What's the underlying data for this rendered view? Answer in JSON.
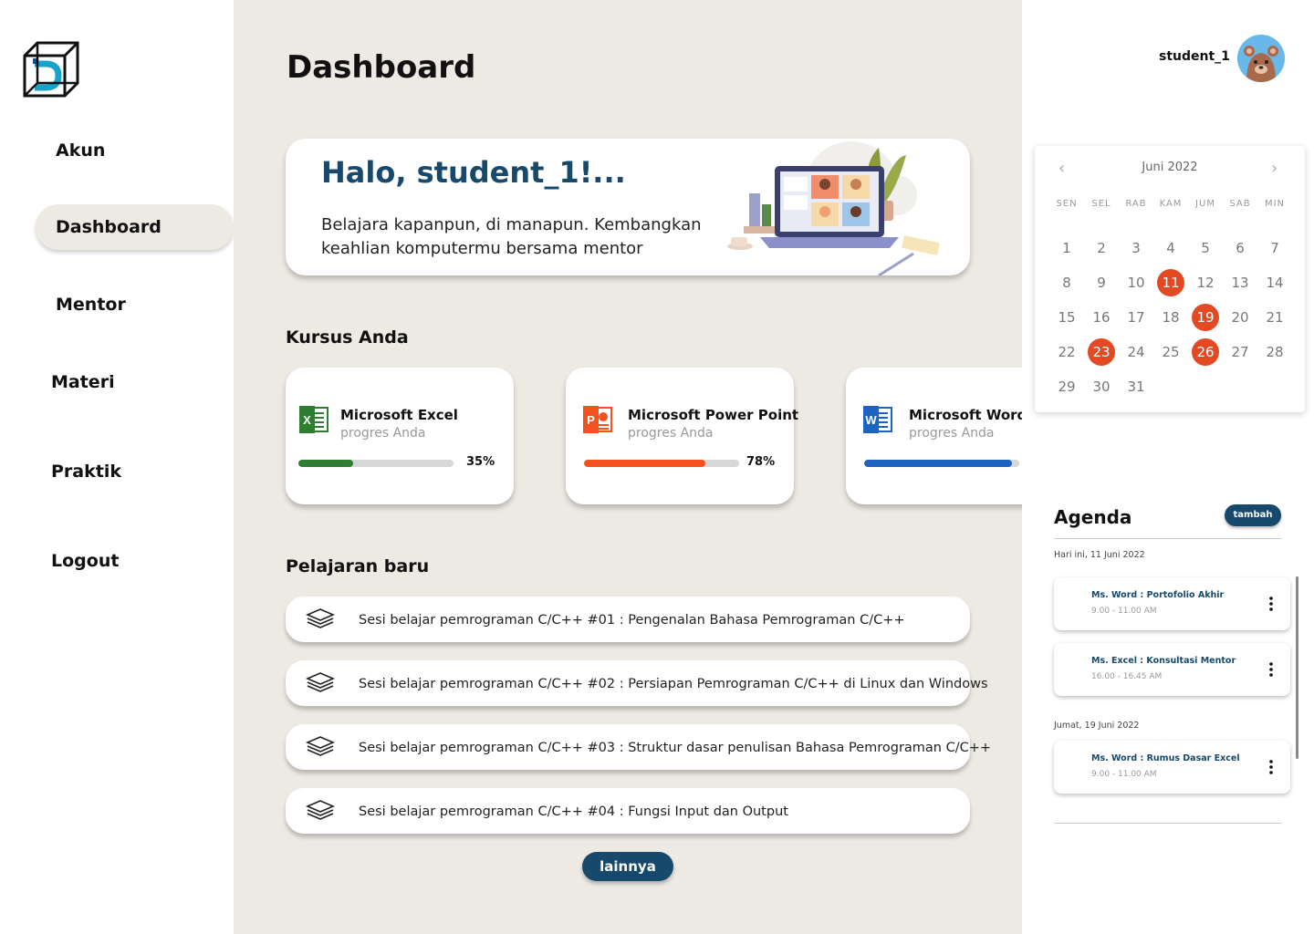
{
  "sidebar": {
    "items": [
      {
        "label": "Akun"
      },
      {
        "label": "Dashboard"
      },
      {
        "label": "Mentor"
      },
      {
        "label": "Materi"
      },
      {
        "label": "Praktik"
      },
      {
        "label": "Logout"
      }
    ],
    "active": "Dashboard"
  },
  "main": {
    "title": "Dashboard",
    "hero": {
      "greeting": "Halo, student_1!...",
      "text": "Belajara kapanpun, di manapun. Kembangkan keahlian komputermu bersama mentor"
    },
    "courses_title": "Kursus Anda",
    "courses": [
      {
        "name": "Microsoft Excel",
        "sub": "progres Anda",
        "progress": 35,
        "progress_label": "35%",
        "color": "#2e7d32",
        "icon": "excel-icon"
      },
      {
        "name": "Microsoft Power Point",
        "sub": "progres Anda",
        "progress": 78,
        "progress_label": "78%",
        "color": "#f4511e",
        "icon": "powerpoint-icon"
      },
      {
        "name": "Microsoft Word",
        "sub": "progres Anda",
        "progress": 95,
        "progress_label": "",
        "color": "#1e63c0",
        "icon": "word-icon"
      }
    ],
    "lessons_title": "Pelajaran baru",
    "lessons": [
      {
        "text": "Sesi belajar pemrograman C/C++ #01 : Pengenalan Bahasa Pemrograman C/C++"
      },
      {
        "text": "Sesi belajar pemrograman C/C++ #02 : Persiapan Pemrograman C/C++ di Linux dan Windows"
      },
      {
        "text": "Sesi belajar pemrograman C/C++ #03 : Struktur dasar penulisan Bahasa Pemrograman C/C++"
      },
      {
        "text": "Sesi belajar pemrograman C/C++ #04 : Fungsi Input dan Output"
      }
    ],
    "more_label": "lainnya"
  },
  "right": {
    "username": "student_1",
    "calendar": {
      "month": "Juni 2022",
      "prev": "‹",
      "next": "›",
      "weekdays": [
        "SEN",
        "SEL",
        "RAB",
        "KAM",
        "JUM",
        "SAB",
        "MIN"
      ],
      "days": [
        "1",
        "2",
        "3",
        "4",
        "5",
        "6",
        "7",
        "8",
        "9",
        "10",
        "11",
        "12",
        "13",
        "14",
        "15",
        "16",
        "17",
        "18",
        "19",
        "20",
        "21",
        "22",
        "23",
        "24",
        "25",
        "26",
        "27",
        "28",
        "29",
        "30",
        "31"
      ],
      "highlighted": [
        "11",
        "19",
        "23",
        "26"
      ],
      "accent": "#e34a23"
    },
    "agenda": {
      "title": "Agenda",
      "add_label": "tambah",
      "groups": [
        {
          "date": "Hari ini, 11 Juni 2022",
          "items": [
            {
              "title": "Ms. Word : Portofolio Akhir",
              "time": "9.00 - 11.00 AM"
            },
            {
              "title": "Ms. Excel : Konsultasi Mentor",
              "time": "16.00 - 16.45 AM"
            }
          ]
        },
        {
          "date": "Jumat, 19 Juni 2022",
          "items": [
            {
              "title": "Ms. Word : Rumus Dasar Excel",
              "time": "9.00 - 11.00 AM"
            }
          ]
        }
      ]
    }
  },
  "colors": {
    "primary": "#16496b",
    "background": "#ede9e3",
    "accent": "#e34a23"
  }
}
